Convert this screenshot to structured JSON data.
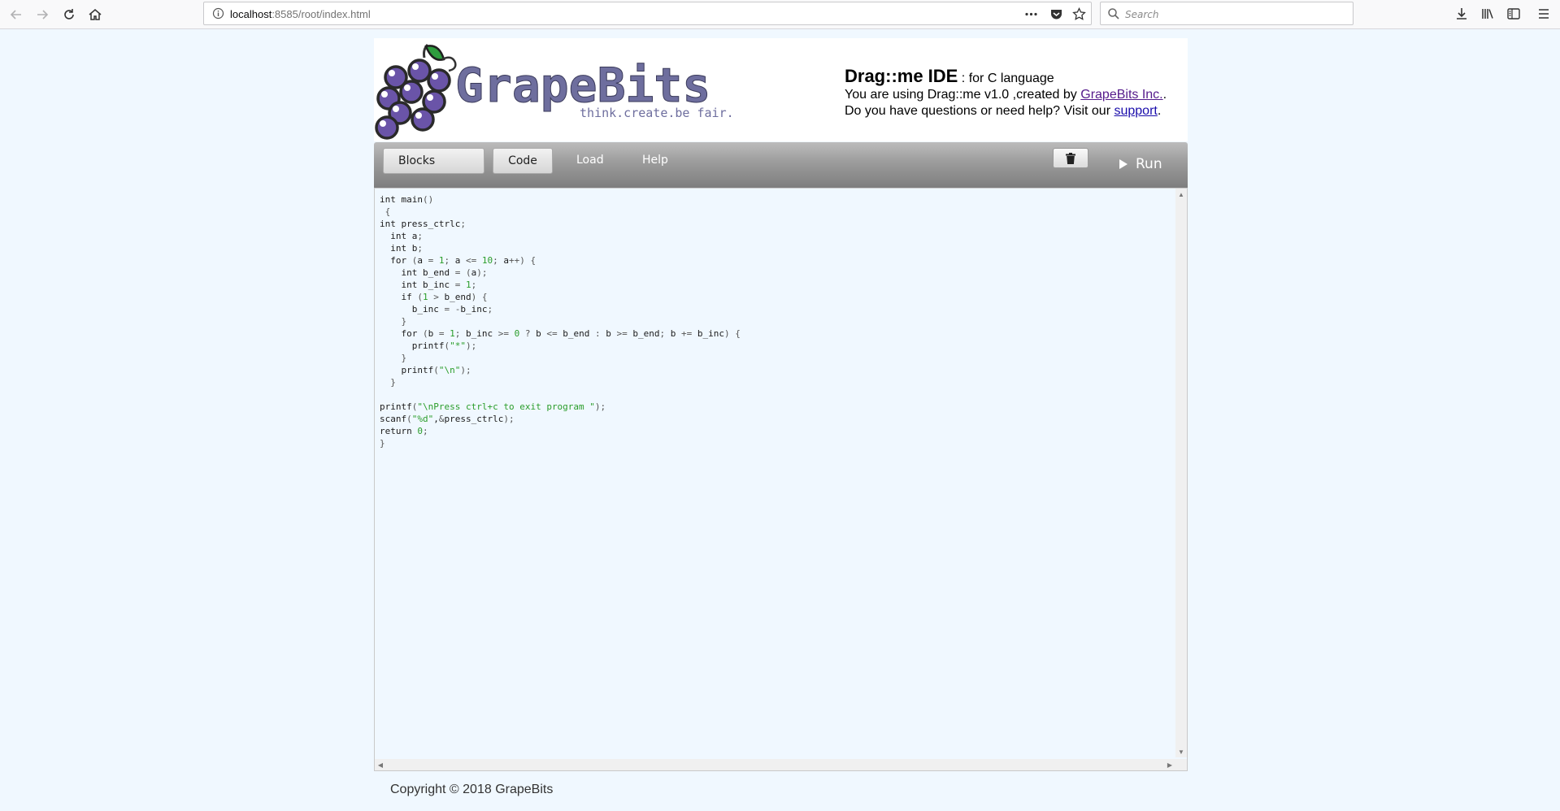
{
  "browser": {
    "url_host": "localhost",
    "url_path": ":8585/root/index.html",
    "search_placeholder": "Search"
  },
  "header": {
    "logo_text": "GrapeBits",
    "logo_tagline": "think.create.be fair.",
    "ide_title": "Drag::me IDE",
    "ide_subtitle": " : for C language",
    "version_prefix": "You are using Drag::me v1.0 ,created by ",
    "company_link": "GrapeBits Inc.",
    "version_suffix": ".",
    "help_prefix": "Do you have questions or need help? Visit our ",
    "support_link": "support",
    "help_suffix": "."
  },
  "toolbar": {
    "blocks_label": "Blocks",
    "code_label": "Code",
    "load_label": "Load",
    "help_label": "Help",
    "run_label": "Run"
  },
  "editor": {
    "lines": [
      "int main()",
      " {",
      "int press_ctrlc;",
      "  int a;",
      "  int b;",
      "  for (a = 1; a <= 10; a++) {",
      "    int b_end = (a);",
      "    int b_inc = 1;",
      "    if (1 > b_end) {",
      "      b_inc = -b_inc;",
      "    }",
      "    for (b = 1; b_inc >= 0 ? b <= b_end : b >= b_end; b += b_inc) {",
      "      printf(\"*\");",
      "    }",
      "    printf(\"\\n\");",
      "  }",
      "",
      "printf(\"\\nPress ctrl+c to exit program \");",
      "scanf(\"%d\",&press_ctrlc);",
      "return 0;",
      "}"
    ]
  },
  "footer": {
    "copyright": "Copyright © 2018 GrapeBits"
  },
  "colors": {
    "page_bg": "#f0f8ff",
    "grape_purple": "#6a54a8",
    "logo_text": "#6e6e9e",
    "leaf_green": "#2e9c3e",
    "toolbar_gray": "#9b9b9b"
  }
}
